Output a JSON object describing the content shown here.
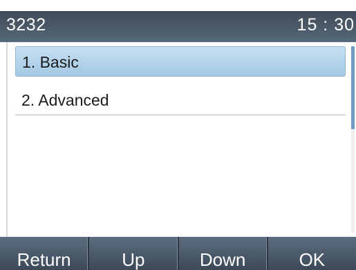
{
  "status_bar": {
    "account": "3232",
    "time": "15 : 30"
  },
  "menu": {
    "items": [
      {
        "label": "1. Basic",
        "selected": true
      },
      {
        "label": "2. Advanced",
        "selected": false
      }
    ]
  },
  "softkeys": {
    "return_label": "Return",
    "up_label": "Up",
    "down_label": "Down",
    "ok_label": "OK"
  },
  "colors": {
    "selection": "#b3d3ea",
    "status_bar": "#4a5866",
    "scrollbar_thumb": "#6f9cc3"
  }
}
